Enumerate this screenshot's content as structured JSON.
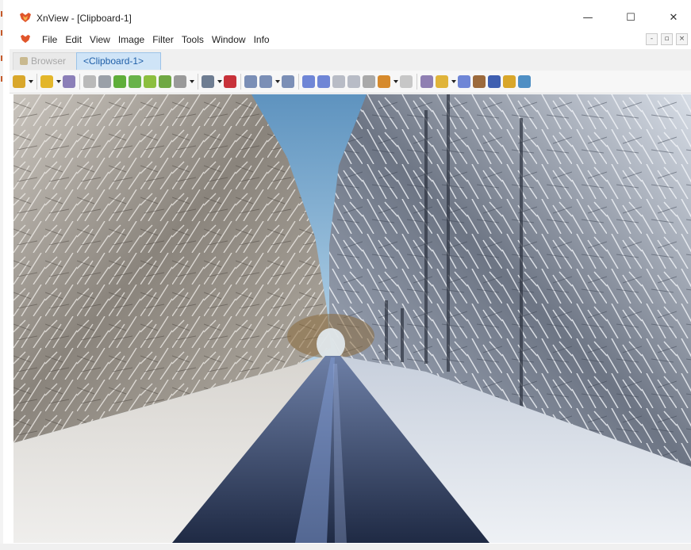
{
  "app": {
    "title": "XnView - [Clipboard-1]",
    "window_controls": {
      "minimize": "—",
      "maximize": "☐",
      "close": "✕"
    }
  },
  "menubar": {
    "items": [
      "File",
      "Edit",
      "View",
      "Image",
      "Filter",
      "Tools",
      "Window",
      "Info"
    ],
    "mdi_controls": [
      "-",
      "▫",
      "×"
    ]
  },
  "tabs": [
    {
      "label": "Browser",
      "active": false
    },
    {
      "label": "<Clipboard-1>",
      "active": true
    }
  ],
  "toolbar": {
    "buttons": [
      {
        "icon": "select-pointer-icon",
        "color": "#d9a72b"
      },
      {
        "icon": "dropdown-arrow",
        "dropdown": true
      },
      {
        "icon": "separator"
      },
      {
        "icon": "open-folder-icon",
        "color": "#e3b62a"
      },
      {
        "icon": "dropdown-arrow",
        "dropdown": true
      },
      {
        "icon": "scanner-icon",
        "color": "#8b7fb8"
      },
      {
        "icon": "separator"
      },
      {
        "icon": "paste-icon",
        "color": "#b9b9b9"
      },
      {
        "icon": "copy-icon",
        "color": "#9aa0a8"
      },
      {
        "icon": "green-globe-icon",
        "color": "#5fae3a"
      },
      {
        "icon": "green-page-icon",
        "color": "#68b34a"
      },
      {
        "icon": "green-folder-icon",
        "color": "#8cbf3f"
      },
      {
        "icon": "green-save-icon",
        "color": "#6fa844"
      },
      {
        "icon": "print-icon",
        "color": "#9a9a9a"
      },
      {
        "icon": "dropdown-arrow",
        "dropdown": true
      },
      {
        "icon": "separator"
      },
      {
        "icon": "slideshow-icon",
        "color": "#6e7d92"
      },
      {
        "icon": "dropdown-arrow",
        "dropdown": true
      },
      {
        "icon": "properties-icon",
        "color": "#c8323a"
      },
      {
        "icon": "separator"
      },
      {
        "icon": "zoom-in-icon",
        "color": "#7b8fb6"
      },
      {
        "icon": "zoom-out-icon",
        "color": "#7b8fb6"
      },
      {
        "icon": "dropdown-arrow",
        "dropdown": true
      },
      {
        "icon": "zoom-fit-icon",
        "color": "#7b8fb6"
      },
      {
        "icon": "separator"
      },
      {
        "icon": "previous-icon",
        "color": "#6f86d6"
      },
      {
        "icon": "next-icon",
        "color": "#6f86d6"
      },
      {
        "icon": "first-icon",
        "color": "#b8bcc6"
      },
      {
        "icon": "last-icon",
        "color": "#b8bcc6"
      },
      {
        "icon": "rotate-icon",
        "color": "#a9a9a9"
      },
      {
        "icon": "crop-icon",
        "color": "#d68a2c"
      },
      {
        "icon": "dropdown-arrow",
        "dropdown": true
      },
      {
        "icon": "fullscreen-icon",
        "color": "#c7c7c7"
      },
      {
        "icon": "separator"
      },
      {
        "icon": "adjust-icon",
        "color": "#8f7fb2"
      },
      {
        "icon": "effects-icon",
        "color": "#e0b43a"
      },
      {
        "icon": "dropdown-arrow",
        "dropdown": true
      },
      {
        "icon": "batch-icon",
        "color": "#6f86d6"
      },
      {
        "icon": "capture-icon",
        "color": "#9c6a3c"
      },
      {
        "icon": "screen-icon",
        "color": "#3f5fb0"
      },
      {
        "icon": "gold-bar-icon",
        "color": "#d9a72b"
      },
      {
        "icon": "info-icon",
        "color": "#4f8fc4"
      }
    ]
  },
  "image": {
    "description_icon": "winter-road-photo"
  }
}
